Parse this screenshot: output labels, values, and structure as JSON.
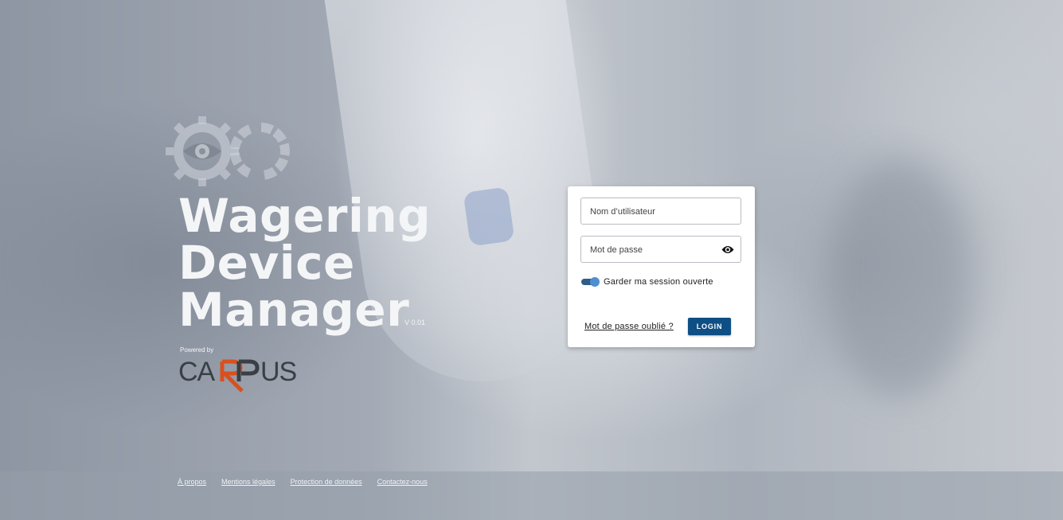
{
  "brand": {
    "title_line1": "Wagering",
    "title_line2": "Device",
    "title_line3": "Manager",
    "version": "V 0.01",
    "powered_by": "Powered by",
    "partner_logo": "CARRUS"
  },
  "login": {
    "username_placeholder": "Nom d’utilisateur",
    "password_placeholder": "Mot de passe",
    "remember_label": "Garder ma session ouverte",
    "remember_checked": true,
    "forgot_link": "Mot de passe oublié ?",
    "login_button": "LOGIN"
  },
  "footer": {
    "links": [
      "À propos",
      "Mentions légales",
      "Protection de données",
      "Contactez-nous"
    ]
  },
  "colors": {
    "primary": "#0e4f86",
    "toggle_on": "#4f8fd0",
    "carrus_dark": "#3a3f46",
    "carrus_accent": "#d9501e"
  },
  "icons": [
    "gear-eye-logo-icon",
    "eye-icon"
  ]
}
